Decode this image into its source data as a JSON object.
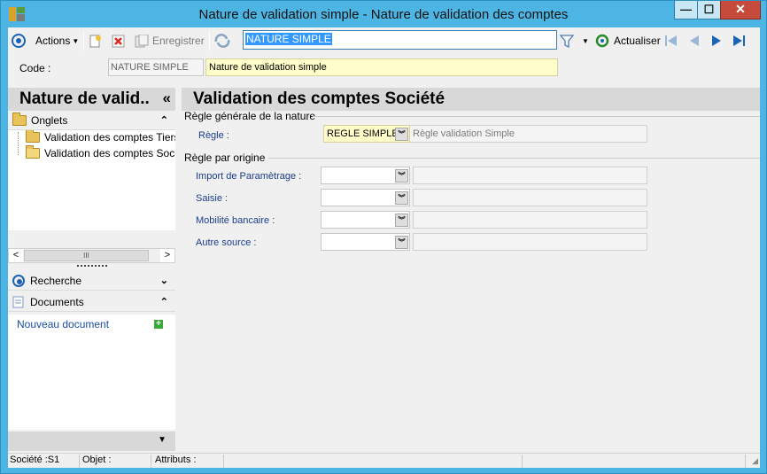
{
  "window": {
    "title": "Nature de validation simple -  Nature de validation des comptes",
    "controls": {
      "minimize": "—",
      "maximize": "☐",
      "close": "✕"
    }
  },
  "toolbar": {
    "actions_label": "Actions",
    "save_label": "Enregistrer",
    "search_value": "NATURE SIMPLE",
    "refresh_label": "Actualiser"
  },
  "header": {
    "code_label": "Code :",
    "code_value": "NATURE SIMPLE",
    "description_value": "Nature de validation simple"
  },
  "left_pane": {
    "title": "Nature de valid..",
    "collapse_glyph": "«",
    "tabs_section": {
      "label": "Onglets",
      "glyph": "⌃"
    },
    "tree_items": [
      {
        "label": "Validation des comptes Tiers"
      },
      {
        "label": "Validation des comptes Société"
      }
    ],
    "search_section": {
      "label": "Recherche",
      "glyph": "⌄"
    },
    "documents_section": {
      "label": "Documents",
      "glyph": "⌃"
    },
    "new_document_label": "Nouveau document",
    "scroll": {
      "left": "<",
      "right": ">",
      "thumb": "III"
    }
  },
  "right_pane": {
    "title": "Validation des comptes Société",
    "general_group": "Règle générale de la nature",
    "rule_label": "Règle  :",
    "rule_value": "REGLE SIMPLE",
    "rule_description": "Règle validation Simple",
    "origin_group": "Règle par origine",
    "origin_fields": [
      {
        "label": "Import de Paramètrage  :",
        "value": ""
      },
      {
        "label": "Saisie :",
        "value": ""
      },
      {
        "label": "Mobilité bancaire :",
        "value": ""
      },
      {
        "label": "Autre source :",
        "value": ""
      }
    ]
  },
  "statusbar": {
    "company": "Société :S1",
    "object": "Objet :",
    "attributes": "Attributs :"
  },
  "colors": {
    "window_frame": "#4cb5e3",
    "highlight_yellow": "#fffdc9",
    "link_blue": "#1a4ea8",
    "close_red": "#c74b3c"
  }
}
